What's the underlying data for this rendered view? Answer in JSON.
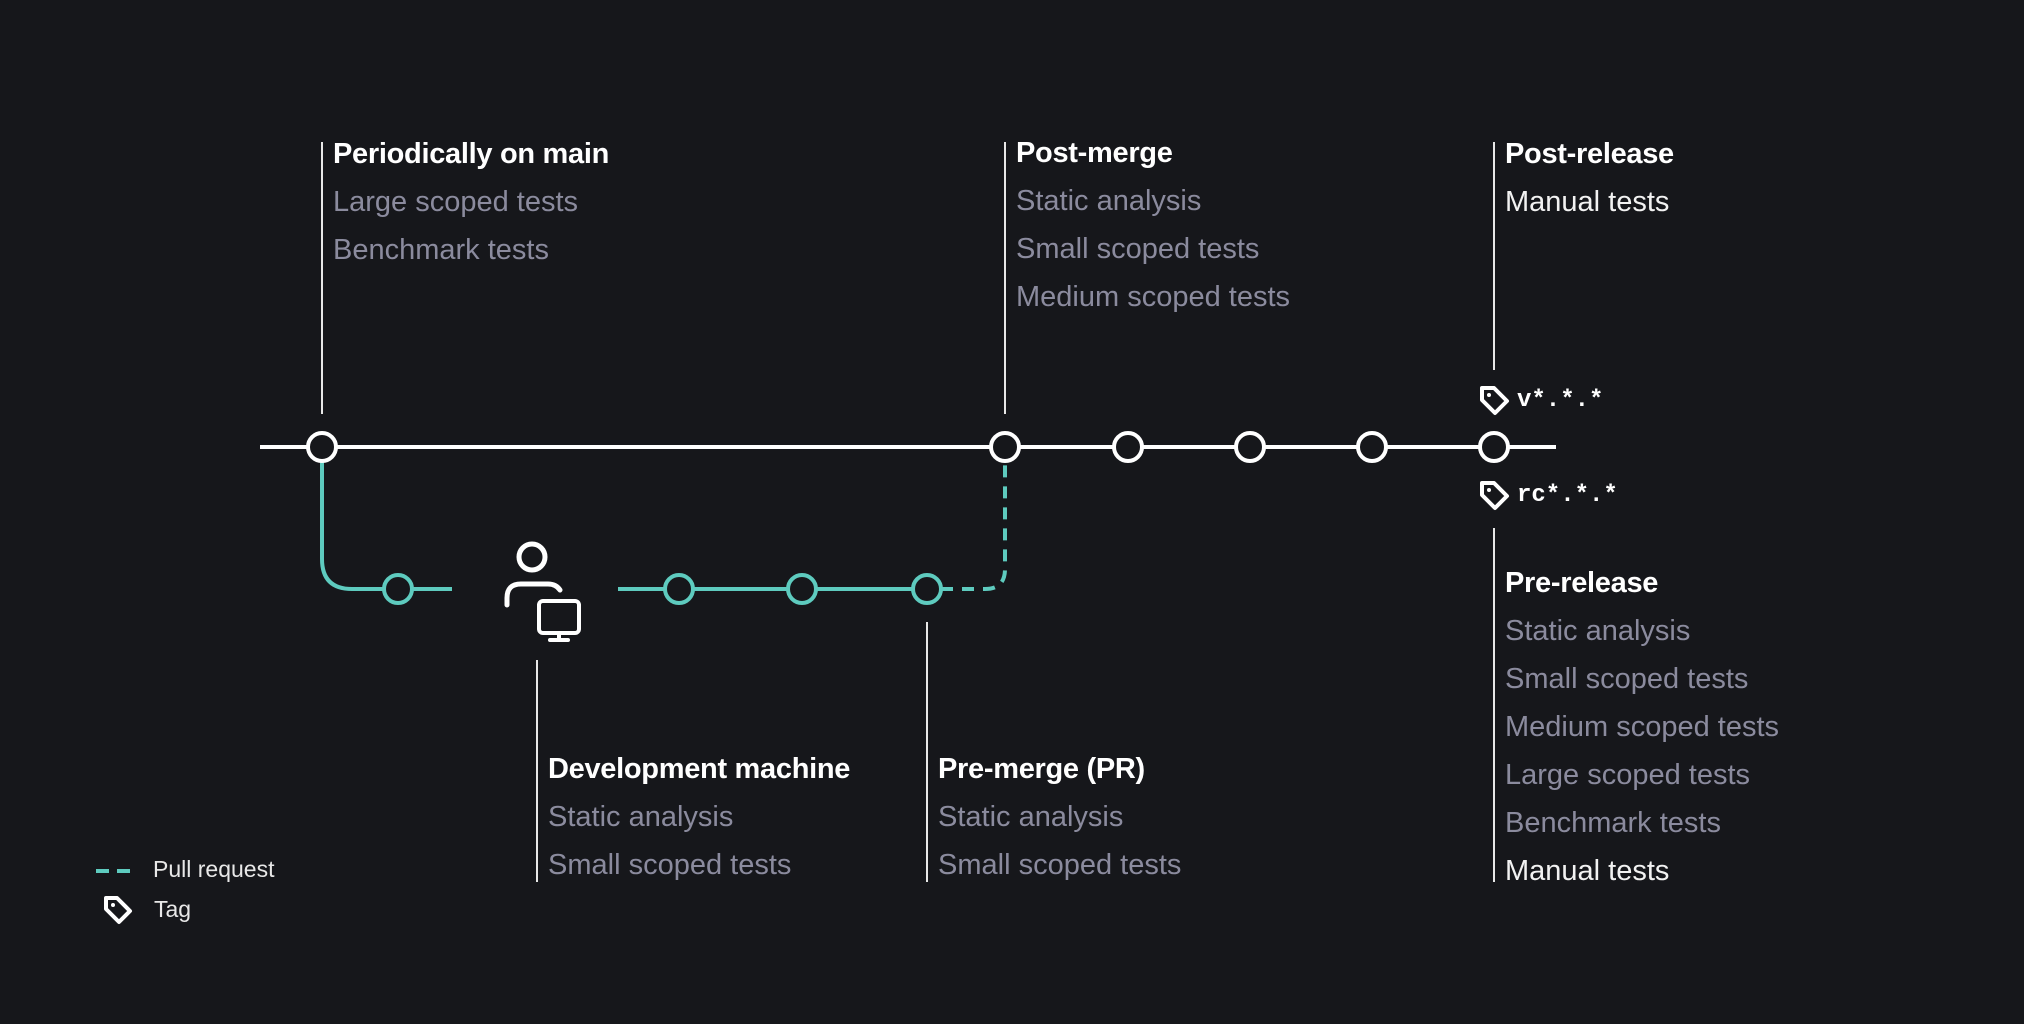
{
  "colors": {
    "background": "#16171b",
    "main_line": "#ffffff",
    "pr_branch": "#5ecbbf",
    "muted_text": "#8b8b9e"
  },
  "stages": {
    "periodically": {
      "title": "Periodically on main",
      "items": [
        "Large scoped tests",
        "Benchmark tests"
      ]
    },
    "post_merge": {
      "title": "Post-merge",
      "items": [
        "Static analysis",
        "Small scoped tests",
        "Medium scoped tests"
      ]
    },
    "post_release": {
      "title": "Post-release",
      "items": [
        "Manual tests"
      ]
    },
    "dev_machine": {
      "title": "Development machine",
      "items": [
        "Static analysis",
        "Small scoped tests"
      ]
    },
    "pre_merge": {
      "title": "Pre-merge (PR)",
      "items": [
        "Static analysis",
        "Small scoped tests"
      ]
    },
    "pre_release": {
      "title": "Pre-release",
      "items": [
        "Static analysis",
        "Small scoped tests",
        "Medium scoped tests",
        "Large scoped tests",
        "Benchmark tests",
        "Manual tests"
      ]
    }
  },
  "tags": {
    "release": "v*.*.*",
    "release_candidate": "rc*.*.*"
  },
  "icons": {
    "tag": "tag-icon",
    "developer": "developer-at-computer-icon"
  },
  "legend": {
    "pull_request": "Pull request",
    "tag": "Tag"
  }
}
